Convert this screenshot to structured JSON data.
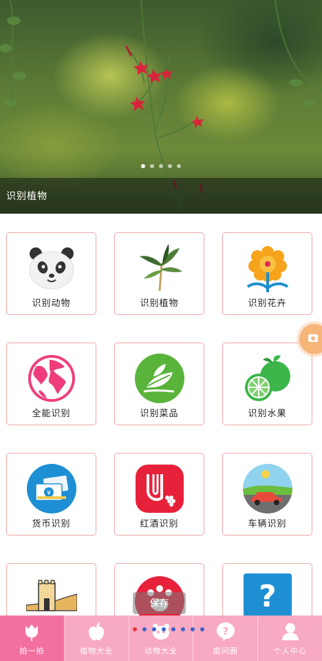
{
  "banner": {
    "caption": "识别植物",
    "slide_count": 5,
    "active_slide": 1
  },
  "grid": {
    "items": [
      {
        "label": "识别动物",
        "icon": "panda-icon"
      },
      {
        "label": "识别植物",
        "icon": "plant-icon"
      },
      {
        "label": "识别花卉",
        "icon": "flower-icon"
      },
      {
        "label": "全能识别",
        "icon": "globe-icon"
      },
      {
        "label": "识别菜品",
        "icon": "leaf-dish-icon"
      },
      {
        "label": "识别水果",
        "icon": "fruit-icon"
      },
      {
        "label": "货币识别",
        "icon": "money-icon"
      },
      {
        "label": "红酒识别",
        "icon": "wine-icon"
      },
      {
        "label": "车辆识别",
        "icon": "car-icon"
      },
      {
        "label": "",
        "icon": "great-wall-icon"
      },
      {
        "label": "",
        "icon": "paw-icon"
      },
      {
        "label": "",
        "icon": "question-icon"
      }
    ]
  },
  "save_overlay": "保存",
  "tabs": [
    {
      "label": "拍一拍",
      "icon": "tulip-icon",
      "active": true
    },
    {
      "label": "植物大全",
      "icon": "apple-icon",
      "active": false
    },
    {
      "label": "动物大全",
      "icon": "panda-face-icon",
      "active": false
    },
    {
      "label": "提问圈",
      "icon": "question-bubble-icon",
      "active": false
    },
    {
      "label": "个人中心",
      "icon": "person-icon",
      "active": false
    }
  ],
  "colors": {
    "card_border": "#f0a6a6",
    "tabbar_bg": "#f8a9c4",
    "tab_active_bg": "#f2709f",
    "float_button": "#f7b57a"
  }
}
